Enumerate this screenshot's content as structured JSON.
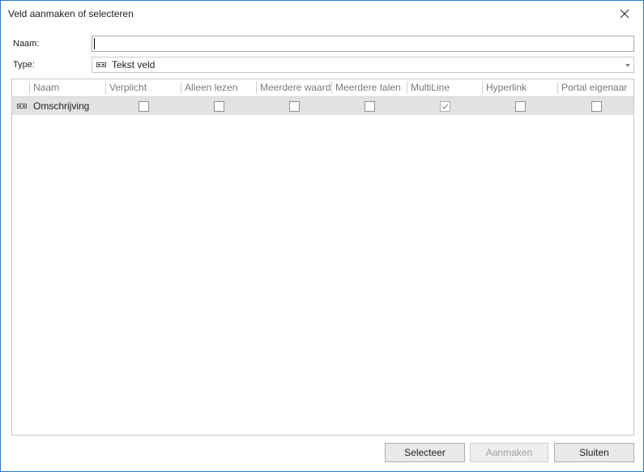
{
  "window": {
    "title": "Veld aanmaken of selecteren"
  },
  "form": {
    "name_label": "Naam:",
    "name_value": "",
    "type_label": "Type:",
    "type_value": "Tekst veld",
    "type_icon": "text-field-icon"
  },
  "grid": {
    "columns": [
      "Naam",
      "Verplicht",
      "Alleen lezen",
      "Meerdere waard",
      "Meerdere talen",
      "MultiLine",
      "Hyperlink",
      "Portal eigenaar"
    ],
    "rows": [
      {
        "icon": "text-field-icon",
        "name": "Omschrijving",
        "verplicht": false,
        "alleen_lezen": false,
        "meerdere_waard": false,
        "meerdere_talen": false,
        "multiline": true,
        "hyperlink": false,
        "portal_eigenaar": false
      }
    ]
  },
  "buttons": {
    "select": "Selecteer",
    "create": "Aanmaken",
    "close": "Sluiten"
  }
}
